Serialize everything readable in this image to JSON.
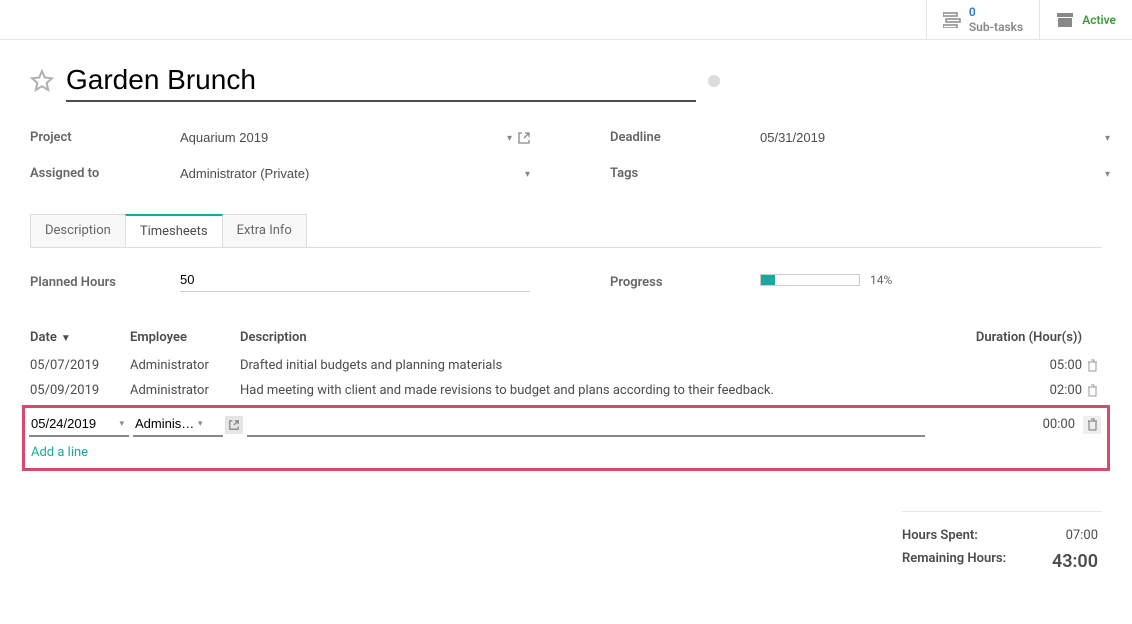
{
  "statusbar": {
    "subtasks_count": "0",
    "subtasks_label": "Sub-tasks",
    "active_label": "Active"
  },
  "title": "Garden Brunch",
  "fields": {
    "project_label": "Project",
    "project_value": "Aquarium 2019",
    "assigned_label": "Assigned to",
    "assigned_value": "Administrator (Private)",
    "deadline_label": "Deadline",
    "deadline_value": "05/31/2019",
    "tags_label": "Tags",
    "tags_value": ""
  },
  "tabs": {
    "description": "Description",
    "timesheets": "Timesheets",
    "extra": "Extra Info"
  },
  "planned": {
    "label": "Planned Hours",
    "value": "50"
  },
  "progress": {
    "label": "Progress",
    "pct": "14%",
    "fill_width": "14%"
  },
  "ts_headers": {
    "date": "Date",
    "employee": "Employee",
    "description": "Description",
    "duration": "Duration (Hour(s))"
  },
  "ts_rows": [
    {
      "date": "05/07/2019",
      "employee": "Administrator",
      "description": "Drafted initial budgets and planning materials",
      "duration": "05:00"
    },
    {
      "date": "05/09/2019",
      "employee": "Administrator",
      "description": "Had meeting with client and made revisions to budget and plans according to their feedback.",
      "duration": "02:00"
    }
  ],
  "ts_edit": {
    "date": "05/24/2019",
    "employee": "Administrator",
    "description": "",
    "duration": "00:00"
  },
  "add_line": "Add a line",
  "summary": {
    "spent_label": "Hours Spent:",
    "spent_value": "07:00",
    "remaining_label": "Remaining Hours:",
    "remaining_value": "43:00"
  }
}
